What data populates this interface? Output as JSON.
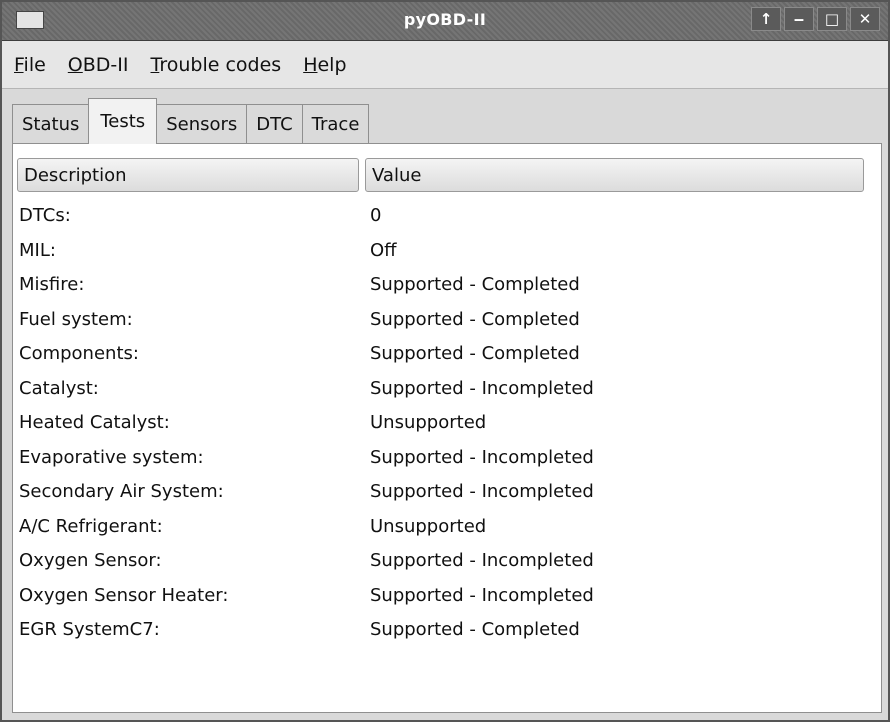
{
  "window": {
    "title": "pyOBD-II",
    "buttons": [
      "↑",
      "‒",
      "□",
      "✕"
    ]
  },
  "menu": [
    {
      "mnemonic": "F",
      "rest": "ile"
    },
    {
      "mnemonic": "O",
      "rest": "BD-II"
    },
    {
      "mnemonic": "T",
      "rest": "rouble codes"
    },
    {
      "mnemonic": "H",
      "rest": "elp"
    }
  ],
  "tabs": [
    "Status",
    "Tests",
    "Sensors",
    "DTC",
    "Trace"
  ],
  "active_tab": "Tests",
  "table": {
    "columns": [
      "Description",
      "Value"
    ],
    "rows": [
      [
        "DTCs:",
        "0"
      ],
      [
        "MIL:",
        "Off"
      ],
      [
        "Misfire:",
        "Supported - Completed"
      ],
      [
        "Fuel system:",
        "Supported - Completed"
      ],
      [
        "Components:",
        "Supported - Completed"
      ],
      [
        "Catalyst:",
        "Supported - Incompleted"
      ],
      [
        "Heated Catalyst:",
        "Unsupported"
      ],
      [
        "Evaporative system:",
        "Supported - Incompleted"
      ],
      [
        "Secondary Air System:",
        "Supported - Incompleted"
      ],
      [
        "A/C Refrigerant:",
        "Unsupported"
      ],
      [
        "Oxygen Sensor:",
        "Supported - Incompleted"
      ],
      [
        "Oxygen Sensor Heater:",
        "Supported - Incompleted"
      ],
      [
        "EGR SystemC7:",
        "Supported - Completed"
      ]
    ]
  }
}
